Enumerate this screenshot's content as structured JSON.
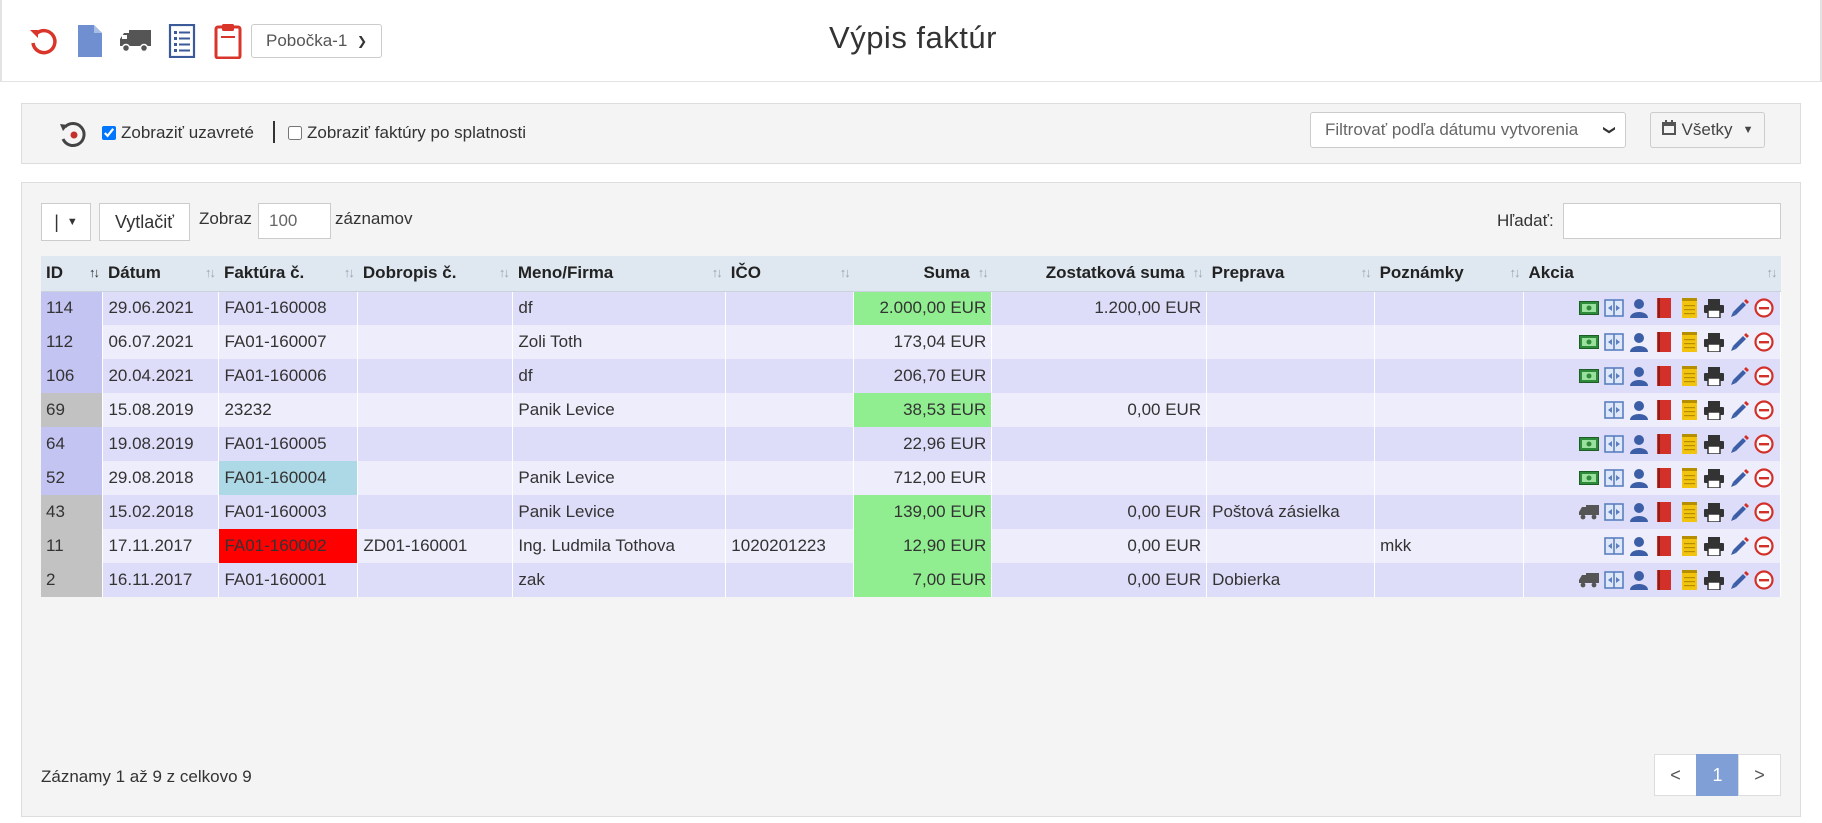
{
  "header": {
    "title": "Výpis faktúr",
    "branch": "Pobočka-1"
  },
  "filters": {
    "show_closed_label": "Zobraziť uzavreté",
    "show_closed": true,
    "show_overdue_label": "Zobraziť faktúry po splatnosti",
    "show_overdue": false,
    "date_filter": "Filtrovať podľa dátumu vytvorenia",
    "period": "Všetky"
  },
  "toolbar": {
    "columns_btn": "|",
    "print_btn": "Vytlačiť",
    "show_label": "Zobraz",
    "page_size": "100",
    "records_label": "záznamov",
    "search_label": "Hľadať:",
    "search_value": ""
  },
  "columns": [
    "ID",
    "Dátum",
    "Faktúra č.",
    "Dobropis č.",
    "Meno/Firma",
    "IČO",
    "Suma",
    "Zostatková suma",
    "Preprava",
    "Poznámky",
    "Akcia"
  ],
  "rows": [
    {
      "id": "114",
      "date": "29.06.2021",
      "invoice": "FA01-160008",
      "credit": "",
      "name": "df",
      "ico": "",
      "sum": "2.000,00 EUR",
      "remaining": "1.200,00 EUR",
      "transport": "",
      "notes": ""
    },
    {
      "id": "112",
      "date": "06.07.2021",
      "invoice": "FA01-160007",
      "credit": "",
      "name": "Zoli Toth",
      "ico": "",
      "sum": "173,04 EUR",
      "remaining": "",
      "transport": "",
      "notes": ""
    },
    {
      "id": "106",
      "date": "20.04.2021",
      "invoice": "FA01-160006",
      "credit": "",
      "name": "df",
      "ico": "",
      "sum": "206,70 EUR",
      "remaining": "",
      "transport": "",
      "notes": ""
    },
    {
      "id": "69",
      "date": "15.08.2019",
      "invoice": "23232",
      "credit": "",
      "name": "Panik Levice",
      "ico": "",
      "sum": "38,53 EUR",
      "remaining": "0,00 EUR",
      "transport": "",
      "notes": ""
    },
    {
      "id": "64",
      "date": "19.08.2019",
      "invoice": "FA01-160005",
      "credit": "",
      "name": "",
      "ico": "",
      "sum": "22,96 EUR",
      "remaining": "",
      "transport": "",
      "notes": ""
    },
    {
      "id": "52",
      "date": "29.08.2018",
      "invoice": "FA01-160004",
      "credit": "",
      "name": "Panik Levice",
      "ico": "",
      "sum": "712,00 EUR",
      "remaining": "",
      "transport": "",
      "notes": ""
    },
    {
      "id": "43",
      "date": "15.02.2018",
      "invoice": "FA01-160003",
      "credit": "",
      "name": "Panik Levice",
      "ico": "",
      "sum": "139,00 EUR",
      "remaining": "0,00 EUR",
      "transport": "Poštová zásielka",
      "notes": ""
    },
    {
      "id": "11",
      "date": "17.11.2017",
      "invoice": "FA01-160002",
      "credit": "ZD01-160001",
      "name": "Ing. Ludmila Tothova",
      "ico": "1020201223",
      "sum": "12,90 EUR",
      "remaining": "0,00 EUR",
      "transport": "",
      "notes": "mkk"
    },
    {
      "id": "2",
      "date": "16.11.2017",
      "invoice": "FA01-160001",
      "credit": "",
      "name": "zak",
      "ico": "",
      "sum": "7,00 EUR",
      "remaining": "0,00 EUR",
      "transport": "Dobierka",
      "notes": ""
    }
  ],
  "footer": {
    "info": "Záznamy 1 až 9 z celkovo 9",
    "prev": "<",
    "page": "1",
    "next": ">"
  },
  "colors": {
    "paid": "#90ee90",
    "overdue": "#ff0000",
    "due_soon": "#add8e6",
    "pager_active": "#7f9fd6"
  }
}
